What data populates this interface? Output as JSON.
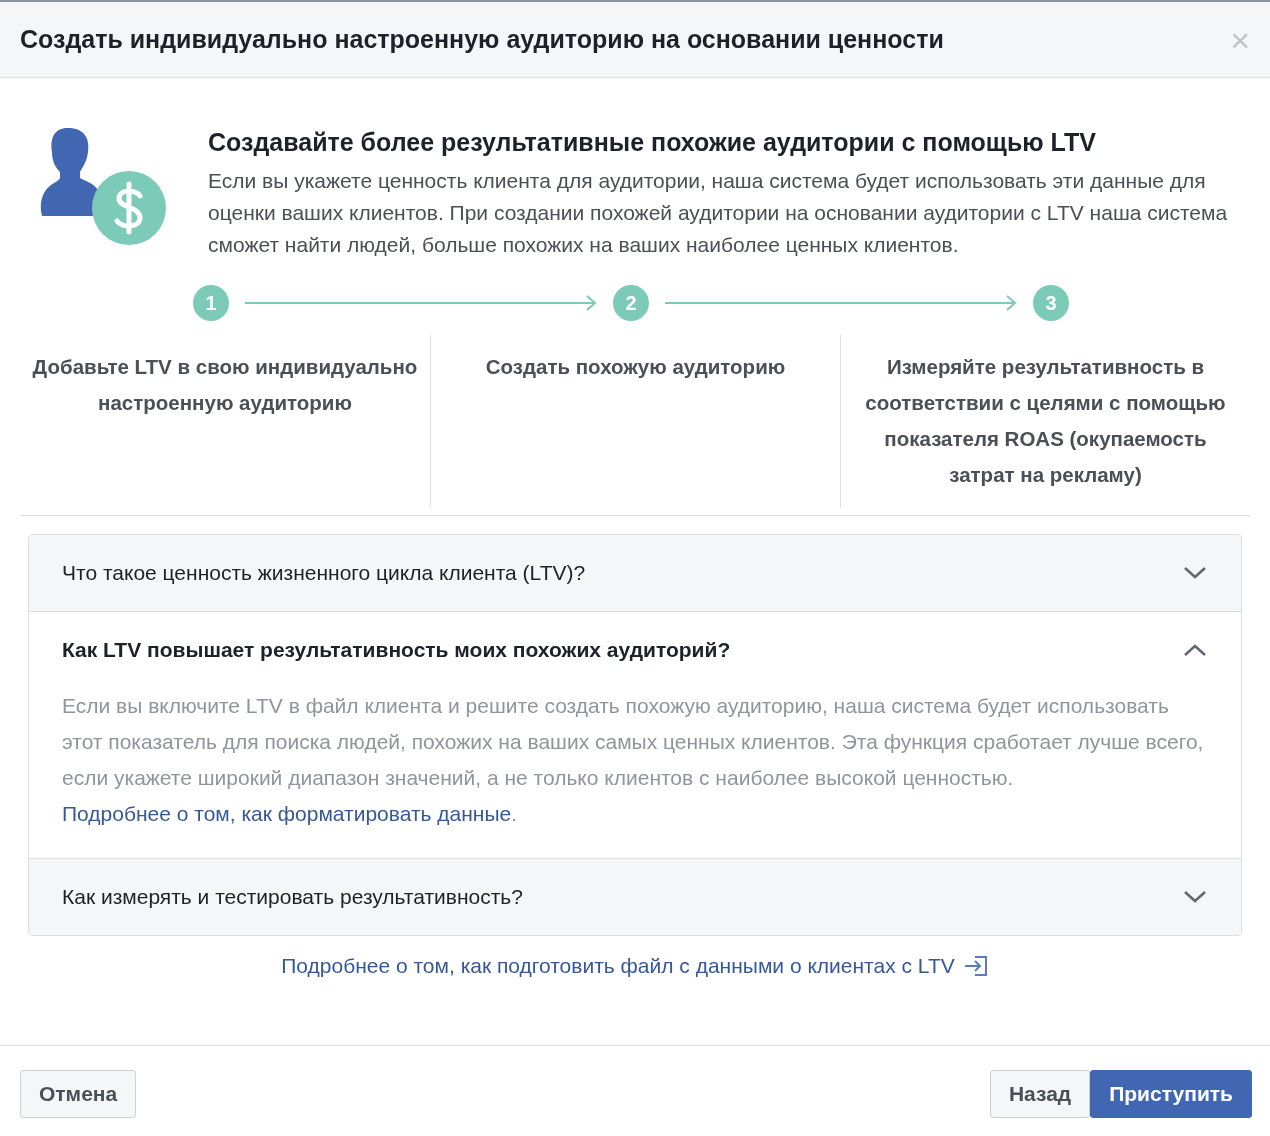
{
  "dialog": {
    "title": "Создать индивидуально настроенную аудиторию на основании ценности",
    "close": "×"
  },
  "intro": {
    "heading": "Создавайте более результативные похожие аудитории с помощью LTV",
    "text": "Если вы укажете ценность клиента для аудитории, наша система будет использовать эти данные для оценки ваших клиентов. При создании похожей аудитории на основании аудитории с LTV наша система сможет найти людей, больше похожих на ваших наиболее ценных клиентов."
  },
  "steps": [
    {
      "number": "1",
      "label": "Добавьте LTV в свою индивидуально настроенную аудиторию"
    },
    {
      "number": "2",
      "label": "Создать похожую аудиторию"
    },
    {
      "number": "3",
      "label": "Измеряйте результативность в соответствии с целями с помощью показателя ROAS (окупаемость затрат на рекламу)"
    }
  ],
  "faq": [
    {
      "question": "Что такое ценность жизненного цикла клиента (LTV)?",
      "expanded": false
    },
    {
      "question": "Как LTV повышает результативность моих похожих аудиторий?",
      "expanded": true,
      "answer": {
        "text": "Если вы включите LTV в файл клиента и решите создать похожую аудиторию, наша система будет использовать этот показатель для поиска людей, похожих на ваших самых ценных клиентов. Эта функция сработает лучше всего, если укажете широкий диапазон значений, а не только клиентов с наиболее высокой ценностью.",
        "link": "Подробнее о том, как форматировать данные",
        "after": "."
      }
    },
    {
      "question": "Как измерять и тестировать результативность?",
      "expanded": false
    }
  ],
  "more_link": "Подробнее о том, как подготовить файл с данными о клиентах с LTV",
  "buttons": {
    "cancel": "Отмена",
    "back": "Назад",
    "start": "Приступить"
  }
}
